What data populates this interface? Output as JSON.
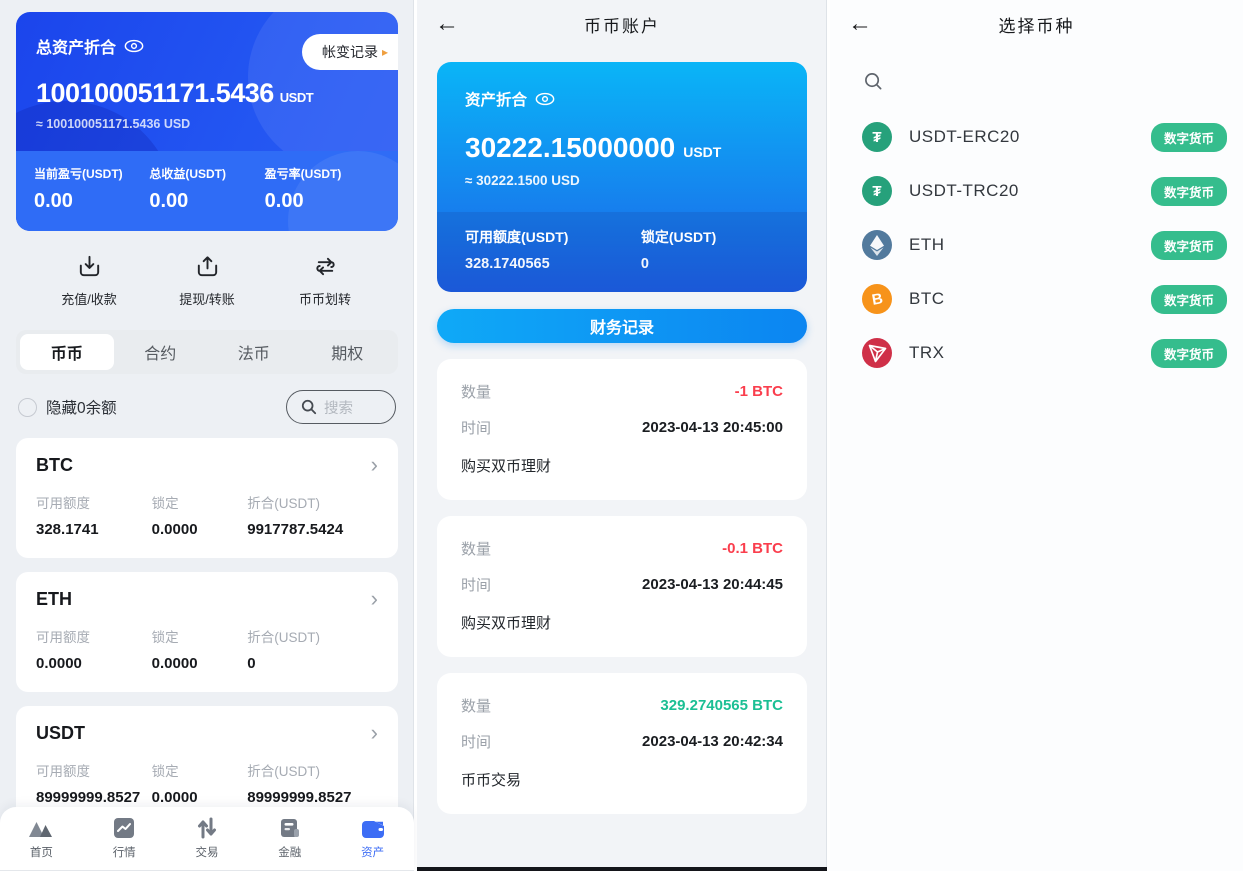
{
  "colors": {
    "primary_blue": "#2356f2",
    "stats_blue": "#2f6cf6",
    "account_gradient_top": "#0ab5f7",
    "account_gradient_bottom": "#1d61e8",
    "records_button_blue": "#0c8cf2",
    "negative_red": "#fa3e4d",
    "positive_green": "#1bbf94",
    "badge_green": "#35bd8d",
    "active_nav_blue": "#3d6df5",
    "usdt_green": "#26a17b",
    "eth_blue": "#527a9d",
    "btc_orange": "#f7931a",
    "trx_red": "#cf3048"
  },
  "panel_assets": {
    "summary": {
      "title": "总资产折合",
      "history_button": "帐变记录",
      "history_arrow": "▸",
      "total": "100100051171.5436",
      "unit": "USDT",
      "approx": "≈ 100100051171.5436 USD",
      "stats": [
        {
          "label": "当前盈亏(USDT)",
          "value": "0.00"
        },
        {
          "label": "总收益(USDT)",
          "value": "0.00"
        },
        {
          "label": "盈亏率(USDT)",
          "value": "0.00"
        }
      ]
    },
    "actions": [
      {
        "label": "充值/收款"
      },
      {
        "label": "提现/转账"
      },
      {
        "label": "币币划转"
      }
    ],
    "tabs": [
      {
        "label": "币币",
        "active": true
      },
      {
        "label": "合约",
        "active": false
      },
      {
        "label": "法币",
        "active": false
      },
      {
        "label": "期权",
        "active": false
      }
    ],
    "hide_zero_label": "隐藏0余额",
    "search_placeholder": "搜索",
    "coin_labels": {
      "available": "可用额度",
      "locked": "锁定",
      "converted": "折合(USDT)"
    },
    "chevron": "›",
    "coins": [
      {
        "symbol": "BTC",
        "available": "328.1741",
        "locked": "0.0000",
        "converted": "9917787.5424"
      },
      {
        "symbol": "ETH",
        "available": "0.0000",
        "locked": "0.0000",
        "converted": "0"
      },
      {
        "symbol": "USDT",
        "available": "89999999.8527",
        "locked": "0.0000",
        "converted": "89999999.8527"
      }
    ],
    "nav": [
      {
        "label": "首页",
        "active": false
      },
      {
        "label": "行情",
        "active": false
      },
      {
        "label": "交易",
        "active": false
      },
      {
        "label": "金融",
        "active": false
      },
      {
        "label": "资产",
        "active": true
      }
    ]
  },
  "panel_account": {
    "back_arrow": "←",
    "title": "币币账户",
    "card": {
      "title": "资产折合",
      "amount": "30222.15000000",
      "unit": "USDT",
      "approx": "≈ 30222.1500 USD",
      "available_label": "可用额度(USDT)",
      "available": "328.1740565",
      "locked_label": "锁定(USDT)",
      "locked": "0"
    },
    "records_button": "财务记录",
    "labels": {
      "qty": "数量",
      "time": "时间"
    },
    "records": [
      {
        "qty": "-1 BTC",
        "qty_color": "#fa3e4d",
        "time": "2023-04-13 20:45:00",
        "desc": "购买双币理财"
      },
      {
        "qty": "-0.1 BTC",
        "qty_color": "#fa3e4d",
        "time": "2023-04-13 20:44:45",
        "desc": "购买双币理财"
      },
      {
        "qty": "329.2740565 BTC",
        "qty_color": "#1bbf94",
        "time": "2023-04-13 20:42:34",
        "desc": "币币交易"
      }
    ]
  },
  "panel_select": {
    "back_arrow": "←",
    "title": "选择币种",
    "badge_label": "数字货币",
    "coins": [
      {
        "name": "USDT-ERC20",
        "icon": "usdt-icon",
        "color": "#26a17b",
        "glyph": "₮"
      },
      {
        "name": "USDT-TRC20",
        "icon": "usdt-icon",
        "color": "#26a17b",
        "glyph": "₮"
      },
      {
        "name": "ETH",
        "icon": "eth-icon",
        "color": "#527a9d",
        "glyph": ""
      },
      {
        "name": "BTC",
        "icon": "btc-icon",
        "color": "#f7931a",
        "glyph": "B"
      },
      {
        "name": "TRX",
        "icon": "trx-icon",
        "color": "#cf3048",
        "glyph": ""
      }
    ]
  }
}
